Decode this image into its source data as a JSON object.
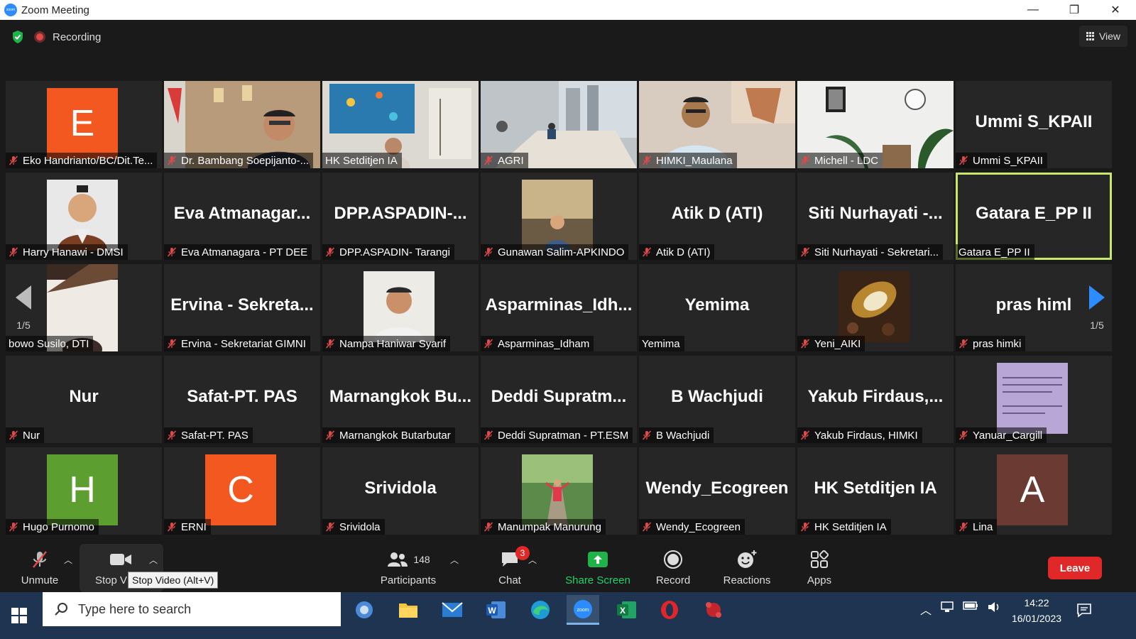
{
  "window": {
    "title": "Zoom Meeting",
    "minimize": "—",
    "restore": "❐",
    "close": "✕"
  },
  "topbar": {
    "recording_label": "Recording",
    "view_label": "View"
  },
  "colors": {
    "accent": "#2d8cff",
    "active_speaker": "#c8e86b",
    "leave": "#e02828",
    "mic_off": "#e0494a"
  },
  "tiles": [
    {
      "label": "Eko Handrianto/BC/Dit.Te...",
      "avatar": "E",
      "avatar_color": "#f2581f",
      "muted": true
    },
    {
      "label": "Dr. Bambang Soepijanto-...",
      "video": "office-official",
      "muted": true
    },
    {
      "label": "HK Setditjen IA",
      "video": "aquarium-office",
      "muted": false
    },
    {
      "label": "AGRI",
      "video": "meeting-room",
      "muted": true
    },
    {
      "label": "HIMKI_Maulana",
      "video": "man-glasses",
      "muted": true
    },
    {
      "label": "Michell - LDC",
      "video": "white-room-plants",
      "muted": true
    },
    {
      "label": "Ummi S_KPAII",
      "big": "Ummi S_KPAII",
      "muted": true
    },
    {
      "label": "Harry Hanawi - DMSI",
      "photo": "man-portrait",
      "muted": true
    },
    {
      "label": "Eva Atmanagara - PT DEE",
      "big": "Eva  Atmanagar...",
      "muted": true
    },
    {
      "label": "DPP.ASPADIN- Tarangi",
      "big": "DPP.ASPADIN-...",
      "muted": true
    },
    {
      "label": "Gunawan Salim-APKINDO",
      "photo": "man-room",
      "muted": true
    },
    {
      "label": "Atik D (ATI)",
      "big": "Atik D (ATI)",
      "muted": true
    },
    {
      "label": "Siti Nurhayati - Sekretari...",
      "big": "Siti  Nurhayati  -...",
      "muted": true
    },
    {
      "label": "Gatara E_PP II",
      "big": "Gatara E_PP II",
      "muted": false,
      "active": true
    },
    {
      "label": "bowo Susilo, DTI",
      "photo": "ceiling-face",
      "muted": false
    },
    {
      "label": "Ervina - Sekretariat GIMNI",
      "big": "Ervina  -  Sekreta...",
      "muted": true
    },
    {
      "label": "Nampa Haniwar Syarif",
      "photo": "man-portrait-2",
      "muted": true
    },
    {
      "label": "Asparminas_Idham",
      "big": "Asparminas_Idh...",
      "muted": true
    },
    {
      "label": "Yemima",
      "big": "Yemima",
      "muted": false
    },
    {
      "label": "Yeni_AIKI",
      "photo": "cocoa",
      "muted": true
    },
    {
      "label": "pras himki",
      "big": "pras himl",
      "muted": true
    },
    {
      "label": "Nur",
      "big": "Nur",
      "muted": true
    },
    {
      "label": "Safat-PT. PAS",
      "big": "Safat-PT. PAS",
      "muted": true
    },
    {
      "label": "Marnangkok Butarbutar",
      "big": "Marnangkok  Bu...",
      "muted": true
    },
    {
      "label": "Deddi Supratman - PT.ESM",
      "big": "Deddi  Supratm...",
      "muted": true
    },
    {
      "label": "B Wachjudi",
      "big": "B Wachjudi",
      "muted": true
    },
    {
      "label": "Yakub Firdaus, HIMKI",
      "big": "Yakub  Firdaus,...",
      "muted": true
    },
    {
      "label": "Yanuar_Cargill",
      "photo": "poster",
      "muted": true
    },
    {
      "label": "Hugo Purnomo",
      "avatar": "H",
      "avatar_color": "#5c9e2f",
      "muted": true
    },
    {
      "label": "ERNI",
      "avatar": "C",
      "avatar_color": "#f2581f",
      "muted": true
    },
    {
      "label": "Srividola",
      "big": "Srividola",
      "muted": true
    },
    {
      "label": "Manumpak Manurung",
      "photo": "garden-person",
      "muted": true
    },
    {
      "label": "Wendy_Ecogreen",
      "big": "Wendy_Ecogreen",
      "muted": true
    },
    {
      "label": "HK Setditjen IA",
      "big": "HK Setditjen IA",
      "muted": true
    },
    {
      "label": "Lina",
      "avatar": "A",
      "avatar_color": "#6b3a32",
      "muted": true
    }
  ],
  "pagination": {
    "left": "1/5",
    "right": "1/5"
  },
  "toolbar": {
    "unmute": "Unmute",
    "stop_video": "Stop V",
    "participants": "Participants",
    "participants_count": "148",
    "chat": "Chat",
    "chat_badge": "3",
    "share": "Share Screen",
    "record": "Record",
    "reactions": "Reactions",
    "apps": "Apps",
    "leave": "Leave"
  },
  "tooltip": "Stop Video (Alt+V)",
  "taskbar": {
    "search_placeholder": "Type here to search",
    "time": "14:22",
    "date": "16/01/2023"
  }
}
